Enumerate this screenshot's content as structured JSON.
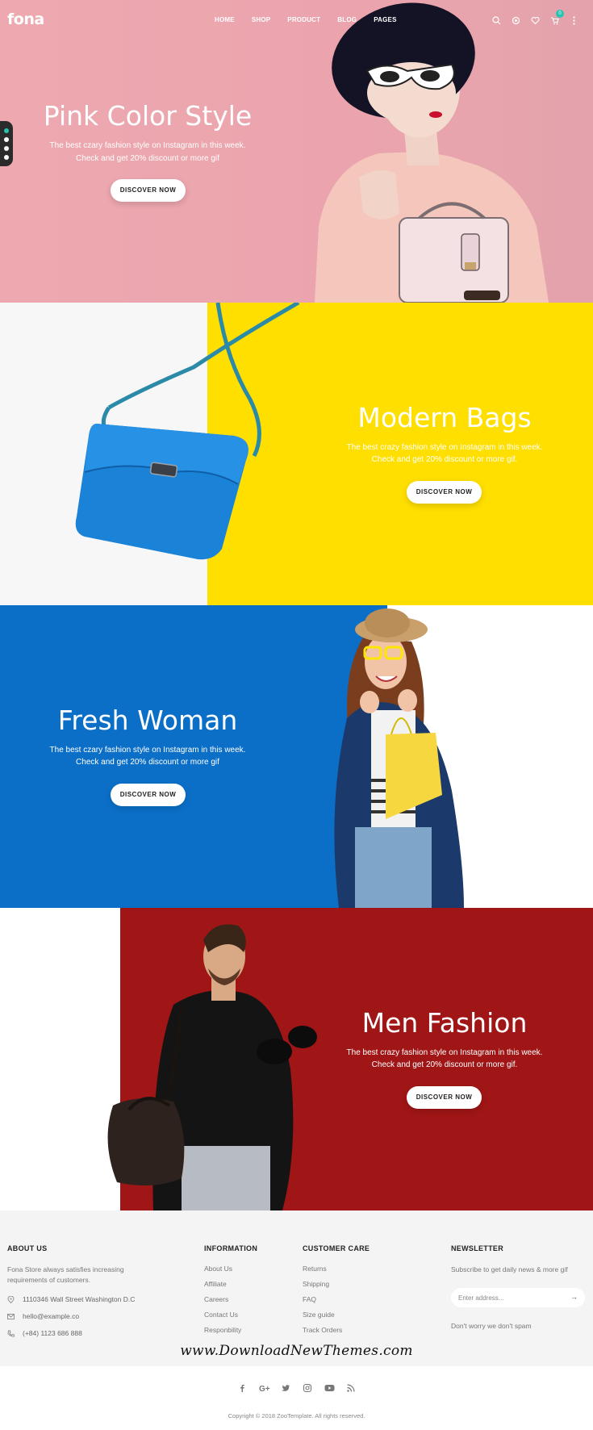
{
  "header": {
    "logo": "fona",
    "nav": [
      "HOME",
      "SHOP",
      "PRODUCT",
      "BLOG",
      "PAGES"
    ],
    "cart_count": "0",
    "icons": [
      "search-icon",
      "settings-icon",
      "heart-icon",
      "cart-icon",
      "more-icon"
    ]
  },
  "slides": [
    {
      "title": "Pink Color Style",
      "desc1": "The best czary fashion style on Instagram in this week.",
      "desc2": "Check and get 20% discount or more gif",
      "button": "DISCOVER NOW",
      "bg": "#eda8b0"
    },
    {
      "title": "Modern Bags",
      "desc1": "The best crazy fashion style on Instagram in this week.",
      "desc2": "Check and get 20% discount or more gif.",
      "button": "DISCOVER NOW",
      "bg": "#ffdf00"
    },
    {
      "title": "Fresh Woman",
      "desc1": "The best czary fashion style on Instagram in this week.",
      "desc2": "Check and get 20% discount or more gif",
      "button": "DISCOVER NOW",
      "bg": "#0b6fc7"
    },
    {
      "title": "Men Fashion",
      "desc1": "The best crazy fashion style on Instagram in this week.",
      "desc2": "Check and get 20% discount or more gif.",
      "button": "DISCOVER NOW",
      "bg": "#a01616"
    }
  ],
  "footer": {
    "about": {
      "heading": "ABOUT US",
      "text1": "Fona Store always satisfies increasing",
      "text2": "requirements of customers.",
      "address": "1110346 Wall Street Washington D.C",
      "email": "hello@example.co",
      "phone": "(+84) 1123 686 888"
    },
    "information": {
      "heading": "INFORMATION",
      "links": [
        "About Us",
        "Affiliate",
        "Careers",
        "Contact Us",
        "Responbility"
      ]
    },
    "customer_care": {
      "heading": "CUSTOMER CARE",
      "links": [
        "Returns",
        "Shipping",
        "FAQ",
        "Size guide",
        "Track Orders"
      ]
    },
    "newsletter": {
      "heading": "NEWSLETTER",
      "text": "Subscribe to get daily news & more gif",
      "placeholder": "Enter address...",
      "note": "Don't worry we don't spam"
    },
    "social": [
      "facebook-icon",
      "google-plus-icon",
      "twitter-icon",
      "instagram-icon",
      "youtube-icon",
      "rss-icon"
    ],
    "copyright": "Copyright © 2018 ZooTemplate. All rights reserved."
  },
  "watermark": "www.DownloadNewThemes.com",
  "colors": {
    "accent": "#27c3b1",
    "pink": "#eda8b0",
    "yellow": "#ffdf00",
    "blue": "#0b6fc7",
    "red": "#a01616"
  }
}
